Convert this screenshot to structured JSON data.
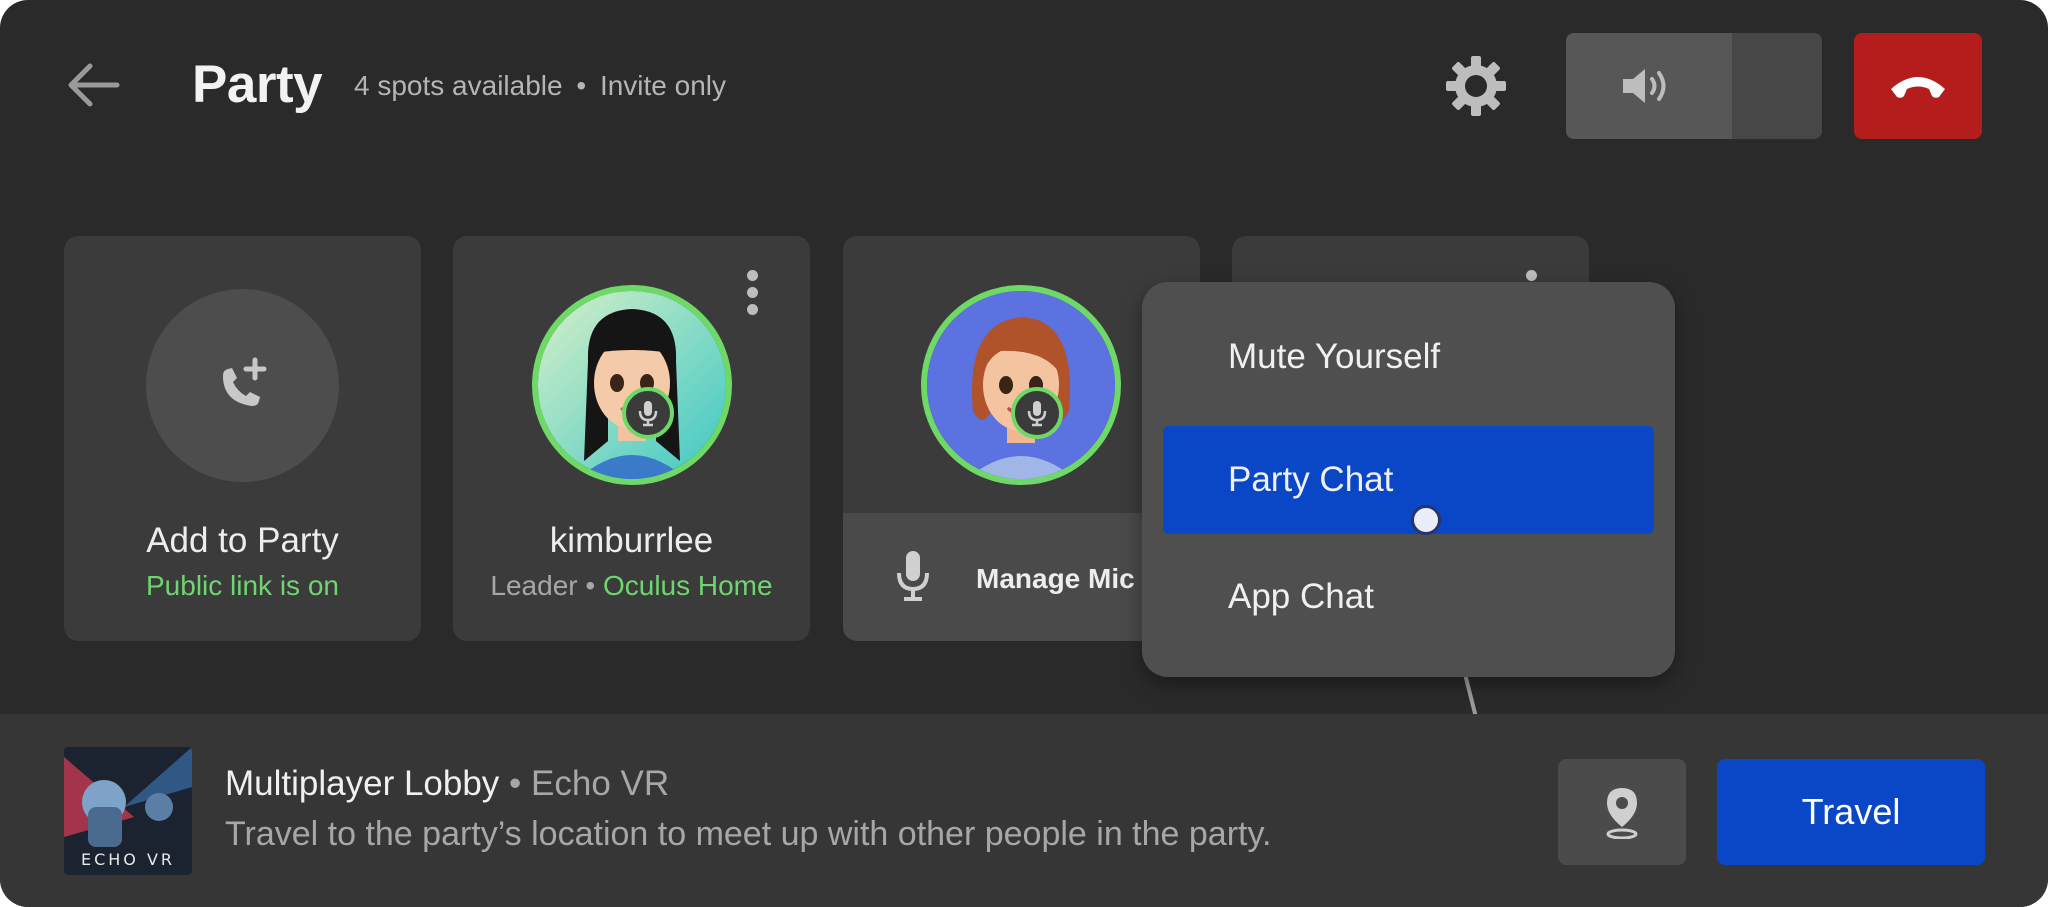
{
  "header": {
    "title": "Party",
    "spots": "4 spots available",
    "separator": "•",
    "visibility": "Invite only",
    "icons": {
      "back": "back-arrow-icon",
      "settings": "gear-icon",
      "volume": "speaker-icon",
      "hangup": "phone-hangup-icon"
    }
  },
  "cards": {
    "add": {
      "label": "Add to Party",
      "status": "Public link is on"
    },
    "member1": {
      "name": "kimburrlee",
      "role": "Leader",
      "separator": "•",
      "location": "Oculus Home"
    },
    "member2": {
      "manage_label": "Manage Mic"
    }
  },
  "menu": {
    "items": [
      {
        "label": "Mute Yourself"
      },
      {
        "label": "Party Chat",
        "selected": true
      },
      {
        "label": "App Chat"
      }
    ]
  },
  "footer": {
    "lobby": "Multiplayer Lobby",
    "separator": "•",
    "game": "Echo VR",
    "thumb_text": "ECHO VR",
    "description": "Travel to the party’s location to meet up with other people in the party.",
    "travel_label": "Travel",
    "location_icon": "map-pin-icon"
  },
  "colors": {
    "accent_blue": "#0a47c7",
    "hangup_red": "#b51c1c",
    "online_green": "#6ed66e",
    "panel_bg": "#2a2a2a"
  }
}
